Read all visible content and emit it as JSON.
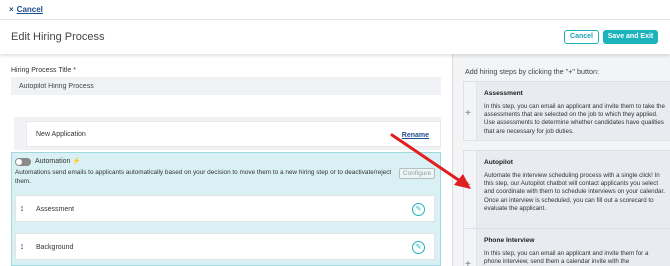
{
  "topbar": {
    "cancel_label": "Cancel",
    "cancel_icon": "×"
  },
  "header": {
    "title": "Edit Hiring Process",
    "cancel_button": "Cancel",
    "save_button": "Save and Exit"
  },
  "form": {
    "title_label": "Hiring Process Title",
    "required_marker": "*",
    "title_value": "Autopilot Hiring Process"
  },
  "steps": {
    "first": {
      "label": "New Application",
      "rename": "Rename"
    },
    "automation": {
      "label": "Automation",
      "icon": "bolt-icon",
      "description": "Automations send emails to applicants automatically based on your decision to move them to a new hiring step or to deactivate/reject them.",
      "configure": "Configure",
      "enabled": false
    },
    "assessment": {
      "label": "Assessment",
      "drag_glyph": "↕",
      "edit_glyph": "✎"
    },
    "background": {
      "label": "Background",
      "drag_glyph": "↕",
      "edit_glyph": "✎"
    }
  },
  "sidebar": {
    "heading": "Add hiring steps by clicking the \"+\" button:",
    "plus_glyph": "+",
    "cards": [
      {
        "title": "Assessment",
        "description": "In this step, you can email an applicant and invite them to take the assessments that are selected on the job to which they applied. Use assessments to determine whether candidates have qualities that are necessary for job duties."
      },
      {
        "title": "Autopilot",
        "description": "Automate the interview scheduling process with a single click! In this step, our Autopilot chatbot will contact applicants you select and coordinate with them to schedule interviews on your calendar. Once an interview is scheduled, you can fill out a scorecard to evaluate the applicant."
      },
      {
        "title": "Phone Interview",
        "description": "In this step, you can email an applicant and invite them for a phone interview, send them a calendar invite with the"
      }
    ]
  },
  "colors": {
    "accent": "#1db3bd",
    "link": "#1f4e8c",
    "annotation_arrow": "#e02020"
  }
}
